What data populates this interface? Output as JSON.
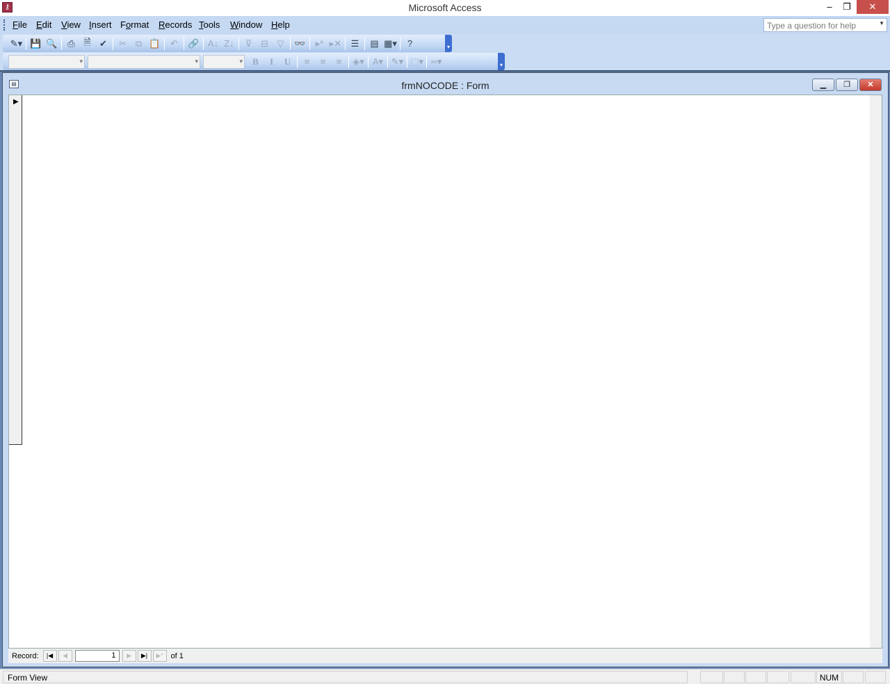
{
  "app": {
    "title": "Microsoft Access",
    "icon": "access-key-icon"
  },
  "window_controls": {
    "minimize": "–",
    "restore": "❐",
    "close": "✕"
  },
  "menu": [
    {
      "label": "File"
    },
    {
      "label": "Edit"
    },
    {
      "label": "View"
    },
    {
      "label": "Insert"
    },
    {
      "label": "Format"
    },
    {
      "label": "Records"
    },
    {
      "label": "Tools"
    },
    {
      "label": "Window"
    },
    {
      "label": "Help"
    }
  ],
  "help_box": {
    "placeholder": "Type a question for help"
  },
  "toolbar1": [
    {
      "name": "view-icon",
      "g": "✎▾"
    },
    {
      "sep": 1
    },
    {
      "name": "save-icon",
      "g": "💾"
    },
    {
      "name": "file-search-icon",
      "g": "🔍"
    },
    {
      "sep": 1
    },
    {
      "name": "print-icon",
      "g": "⎙"
    },
    {
      "name": "print-preview-icon",
      "g": "🗎"
    },
    {
      "name": "spelling-icon",
      "g": "✔"
    },
    {
      "sep": 1
    },
    {
      "name": "cut-icon",
      "g": "✂",
      "d": 1
    },
    {
      "name": "copy-icon",
      "g": "⧉",
      "d": 1
    },
    {
      "name": "paste-icon",
      "g": "📋",
      "d": 1
    },
    {
      "sep": 1
    },
    {
      "name": "undo-icon",
      "g": "↶",
      "d": 1
    },
    {
      "sep": 1
    },
    {
      "name": "hyperlink-icon",
      "g": "🔗",
      "d": 1
    },
    {
      "sep": 1
    },
    {
      "name": "sort-ascending-icon",
      "g": "A↓",
      "d": 1
    },
    {
      "name": "sort-descending-icon",
      "g": "Z↓",
      "d": 1
    },
    {
      "sep": 1
    },
    {
      "name": "filter-by-selection-icon",
      "g": "⊽",
      "d": 1
    },
    {
      "name": "filter-by-form-icon",
      "g": "⊟",
      "d": 1
    },
    {
      "name": "apply-filter-icon",
      "g": "▽",
      "d": 1
    },
    {
      "sep": 1
    },
    {
      "name": "find-icon",
      "g": "👓"
    },
    {
      "sep": 1
    },
    {
      "name": "new-record-icon",
      "g": "▸*",
      "d": 1
    },
    {
      "name": "delete-record-icon",
      "g": "▸✕",
      "d": 1
    },
    {
      "sep": 1
    },
    {
      "name": "properties-icon",
      "g": "☰"
    },
    {
      "sep": 1
    },
    {
      "name": "database-window-icon",
      "g": "▤"
    },
    {
      "name": "new-object-icon",
      "g": "▦▾"
    },
    {
      "sep": 1
    },
    {
      "name": "help-icon",
      "g": "?"
    }
  ],
  "toolbar2": [
    {
      "name": "bold-icon",
      "g": "B",
      "d": 1
    },
    {
      "name": "italic-icon",
      "g": "I",
      "d": 1
    },
    {
      "name": "underline-icon",
      "g": "U",
      "d": 1
    },
    {
      "sep": 1
    },
    {
      "name": "align-left-icon",
      "g": "≡",
      "d": 1
    },
    {
      "name": "align-center-icon",
      "g": "≡",
      "d": 1
    },
    {
      "name": "align-right-icon",
      "g": "≡",
      "d": 1
    },
    {
      "sep": 1
    },
    {
      "name": "fill-color-icon",
      "g": "◈▾",
      "d": 1
    },
    {
      "sep": 1
    },
    {
      "name": "font-color-icon",
      "g": "A▾",
      "d": 1
    },
    {
      "sep": 1
    },
    {
      "name": "line-color-icon",
      "g": "✎▾",
      "d": 1
    },
    {
      "sep": 1
    },
    {
      "name": "border-icon",
      "g": "⬚▾",
      "d": 1
    },
    {
      "sep": 1
    },
    {
      "name": "line-width-icon",
      "g": "═▾",
      "d": 1
    }
  ],
  "form": {
    "title": "frmNOCODE : Form",
    "min": "▁",
    "restore": "❐",
    "close": "✕"
  },
  "nav": {
    "label": "Record:",
    "current": "1",
    "of": "of 1",
    "first": "|◀",
    "prev": "◀",
    "next": "▶",
    "last": "▶|",
    "new": "▶*"
  },
  "status": {
    "text": "Form View",
    "num": "NUM"
  }
}
